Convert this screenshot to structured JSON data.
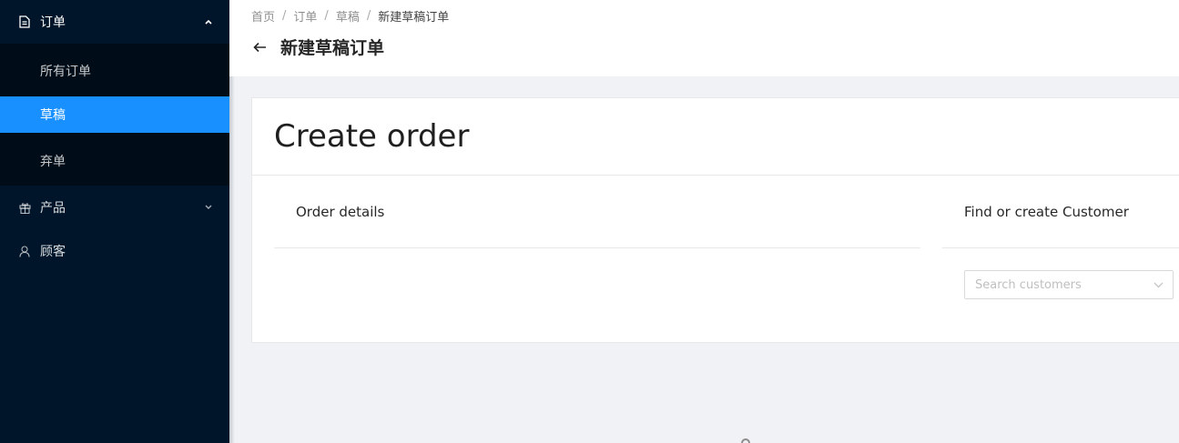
{
  "sidebar": {
    "orders": {
      "label": "订单",
      "submenu": [
        {
          "label": "所有订单"
        },
        {
          "label": "草稿"
        },
        {
          "label": "弃单"
        }
      ]
    },
    "products": {
      "label": "产品"
    },
    "customers": {
      "label": "顾客"
    }
  },
  "header": {
    "breadcrumb": [
      "首页",
      "订单",
      "草稿",
      "新建草稿订单"
    ],
    "title": "新建草稿订单"
  },
  "card": {
    "title": "Create order",
    "order_details": "Order details",
    "customer_section": "Find or create Customer",
    "customer_search_placeholder": "Search customers"
  },
  "colors": {
    "sidebar_bg": "#001529",
    "submenu_bg": "#000c17",
    "active": "#1890ff"
  }
}
